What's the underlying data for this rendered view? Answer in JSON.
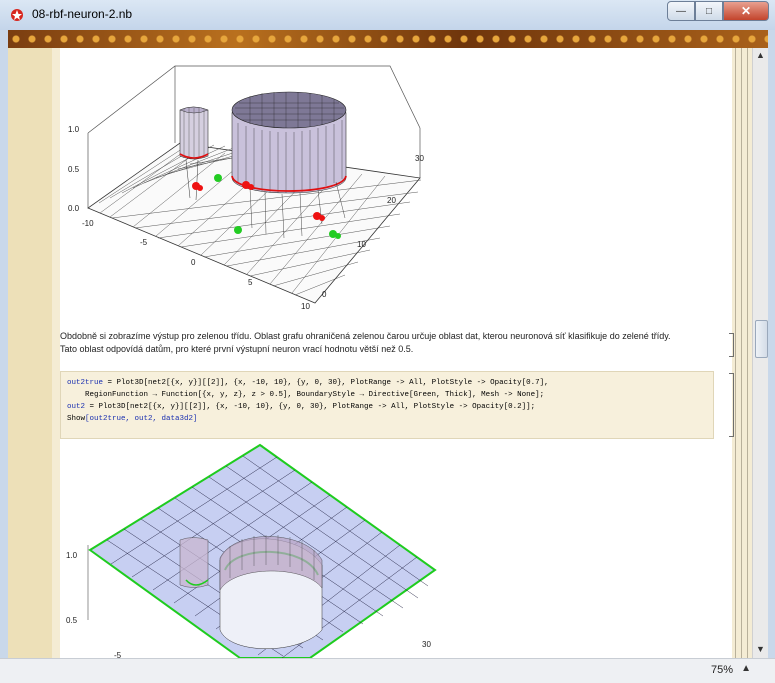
{
  "window": {
    "title": "08-rbf-neuron-2.nb",
    "minimize": "—",
    "maximize": "□",
    "close": "✕"
  },
  "plot1": {
    "z_ticks": [
      "1.0",
      "0.5",
      "0.0"
    ],
    "x_ticks": [
      "-10",
      "-5",
      "0",
      "5",
      "10"
    ],
    "y_ticks": [
      "30",
      "20",
      "10",
      "0"
    ]
  },
  "text_cell": {
    "line1": "Obdobně si zobrazíme výstup pro zelenou třídu. Oblast grafu ohraničená zelenou čarou určuje oblast dat, kterou neuronová síť klasifikuje do zelené třídy.",
    "line2": "Tato oblast odpovídá datům, pro které první výstupní neuron vrací hodnotu větší než 0.5."
  },
  "input_cell": {
    "l1_var": "out2true",
    "l1_rest": " = Plot3D[net2[{x, y}][[2]], {x, -10, 10}, {y, 0, 30}, PlotRange -> All, PlotStyle -> Opacity[0.7],",
    "l2": "    RegionFunction → Function[{x, y, z}, z > 0.5], BoundaryStyle → Directive[Green, Thick], Mesh -> None];",
    "l3_var": "out2",
    "l3_rest": " = Plot3D[net2[{x, y}][[2]], {x, -10, 10}, {y, 0, 30}, PlotRange -> All, PlotStyle -> Opacity[0.2]];",
    "l4_fn": "Show",
    "l4_args": "[out2true, out2, data3d2]"
  },
  "plot2": {
    "z_ticks": [
      "1.0",
      "0.5"
    ],
    "x_ticks": [
      "-5"
    ],
    "y_ticks": [
      "30"
    ]
  },
  "status": {
    "zoom": "75%",
    "zoom_arrow": "▲"
  },
  "scrollbar": {
    "up": "▲",
    "down": "▼"
  }
}
